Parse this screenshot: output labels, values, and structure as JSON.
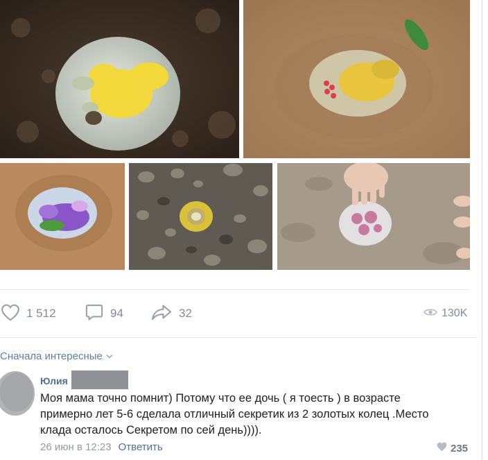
{
  "post": {
    "photos": [
      "Yellow leaf under glass in dark soil",
      "Leaves and red berries under glass in sand",
      "Purple flowers under glass in sand",
      "Yellow leaf under small glass among pebbles",
      "Pink flowers under glass, child's hand"
    ],
    "actions": {
      "likes": "1 512",
      "comments": "94",
      "shares": "32",
      "views": "130K"
    }
  },
  "comments": {
    "sort_label": "Сначала интересные",
    "items": [
      {
        "author": "Юлия",
        "lines": [
          "Моя мама точно помнит) Потому что ее дочь ( я тоесть ) в возрасте",
          "примерно лет 5-6 сделала отличный секретик из 2 золотых колец .Место",
          "клада осталось Секретом по сей день))))."
        ],
        "time": "26 июн в 12:23",
        "reply_label": "Ответить",
        "likes": "235"
      }
    ]
  },
  "colors": {
    "accent_link": "#4a6fa0",
    "icon_gray": "#99a2ad",
    "count_gray": "#818c99"
  }
}
